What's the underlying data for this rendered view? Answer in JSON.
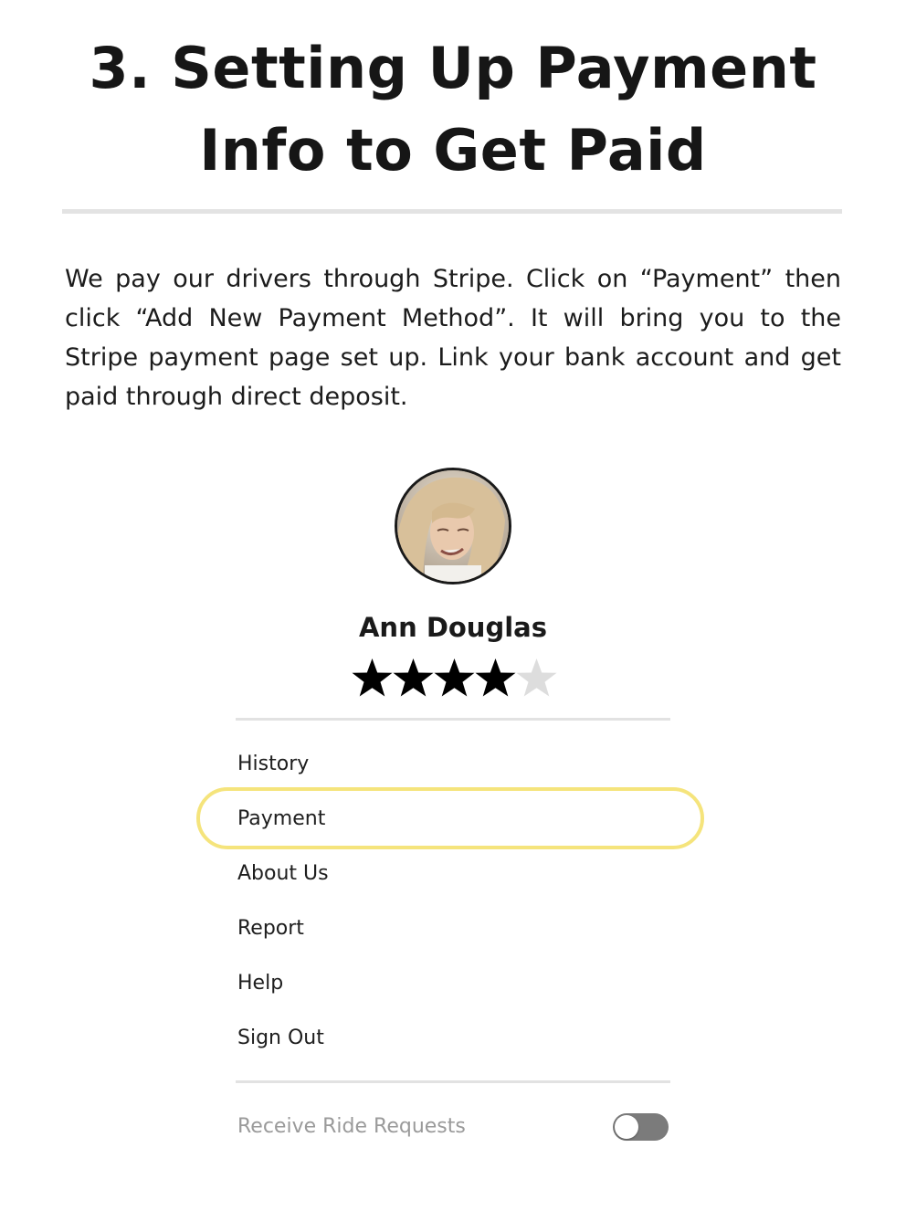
{
  "header": {
    "title_line1": "3. Setting Up Payment",
    "title_line2": "Info to Get Paid"
  },
  "intro": {
    "text": "We pay our drivers through Stripe. Click on “Payment” then click “Add New Payment Method”. It will bring you to the Stripe payment page set up. Link your bank account and get paid through direct deposit."
  },
  "profile": {
    "name": "Ann Douglas",
    "rating": 4,
    "rating_max": 5,
    "star_filled_color": "#000000",
    "star_empty_color": "#dddddd"
  },
  "menu": {
    "items": [
      {
        "label": "History"
      },
      {
        "label": "Payment",
        "highlighted": true
      },
      {
        "label": "About Us"
      },
      {
        "label": "Report"
      },
      {
        "label": "Help"
      },
      {
        "label": "Sign Out"
      }
    ],
    "highlight_color": "#f5e47c"
  },
  "ride_requests": {
    "label": "Receive Ride Requests",
    "enabled": false
  }
}
